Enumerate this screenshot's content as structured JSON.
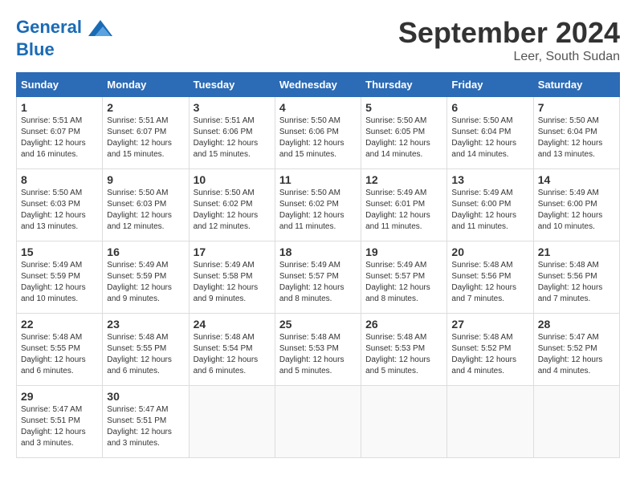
{
  "logo": {
    "line1": "General",
    "line2": "Blue"
  },
  "title": "September 2024",
  "location": "Leer, South Sudan",
  "days_of_week": [
    "Sunday",
    "Monday",
    "Tuesday",
    "Wednesday",
    "Thursday",
    "Friday",
    "Saturday"
  ],
  "weeks": [
    [
      {
        "day": 1,
        "sunrise": "5:51 AM",
        "sunset": "6:07 PM",
        "daylight": "12 hours and 16 minutes."
      },
      {
        "day": 2,
        "sunrise": "5:51 AM",
        "sunset": "6:07 PM",
        "daylight": "12 hours and 15 minutes."
      },
      {
        "day": 3,
        "sunrise": "5:51 AM",
        "sunset": "6:06 PM",
        "daylight": "12 hours and 15 minutes."
      },
      {
        "day": 4,
        "sunrise": "5:50 AM",
        "sunset": "6:06 PM",
        "daylight": "12 hours and 15 minutes."
      },
      {
        "day": 5,
        "sunrise": "5:50 AM",
        "sunset": "6:05 PM",
        "daylight": "12 hours and 14 minutes."
      },
      {
        "day": 6,
        "sunrise": "5:50 AM",
        "sunset": "6:04 PM",
        "daylight": "12 hours and 14 minutes."
      },
      {
        "day": 7,
        "sunrise": "5:50 AM",
        "sunset": "6:04 PM",
        "daylight": "12 hours and 13 minutes."
      }
    ],
    [
      {
        "day": 8,
        "sunrise": "5:50 AM",
        "sunset": "6:03 PM",
        "daylight": "12 hours and 13 minutes."
      },
      {
        "day": 9,
        "sunrise": "5:50 AM",
        "sunset": "6:03 PM",
        "daylight": "12 hours and 12 minutes."
      },
      {
        "day": 10,
        "sunrise": "5:50 AM",
        "sunset": "6:02 PM",
        "daylight": "12 hours and 12 minutes."
      },
      {
        "day": 11,
        "sunrise": "5:50 AM",
        "sunset": "6:02 PM",
        "daylight": "12 hours and 11 minutes."
      },
      {
        "day": 12,
        "sunrise": "5:49 AM",
        "sunset": "6:01 PM",
        "daylight": "12 hours and 11 minutes."
      },
      {
        "day": 13,
        "sunrise": "5:49 AM",
        "sunset": "6:00 PM",
        "daylight": "12 hours and 11 minutes."
      },
      {
        "day": 14,
        "sunrise": "5:49 AM",
        "sunset": "6:00 PM",
        "daylight": "12 hours and 10 minutes."
      }
    ],
    [
      {
        "day": 15,
        "sunrise": "5:49 AM",
        "sunset": "5:59 PM",
        "daylight": "12 hours and 10 minutes."
      },
      {
        "day": 16,
        "sunrise": "5:49 AM",
        "sunset": "5:59 PM",
        "daylight": "12 hours and 9 minutes."
      },
      {
        "day": 17,
        "sunrise": "5:49 AM",
        "sunset": "5:58 PM",
        "daylight": "12 hours and 9 minutes."
      },
      {
        "day": 18,
        "sunrise": "5:49 AM",
        "sunset": "5:57 PM",
        "daylight": "12 hours and 8 minutes."
      },
      {
        "day": 19,
        "sunrise": "5:49 AM",
        "sunset": "5:57 PM",
        "daylight": "12 hours and 8 minutes."
      },
      {
        "day": 20,
        "sunrise": "5:48 AM",
        "sunset": "5:56 PM",
        "daylight": "12 hours and 7 minutes."
      },
      {
        "day": 21,
        "sunrise": "5:48 AM",
        "sunset": "5:56 PM",
        "daylight": "12 hours and 7 minutes."
      }
    ],
    [
      {
        "day": 22,
        "sunrise": "5:48 AM",
        "sunset": "5:55 PM",
        "daylight": "12 hours and 6 minutes."
      },
      {
        "day": 23,
        "sunrise": "5:48 AM",
        "sunset": "5:55 PM",
        "daylight": "12 hours and 6 minutes."
      },
      {
        "day": 24,
        "sunrise": "5:48 AM",
        "sunset": "5:54 PM",
        "daylight": "12 hours and 6 minutes."
      },
      {
        "day": 25,
        "sunrise": "5:48 AM",
        "sunset": "5:53 PM",
        "daylight": "12 hours and 5 minutes."
      },
      {
        "day": 26,
        "sunrise": "5:48 AM",
        "sunset": "5:53 PM",
        "daylight": "12 hours and 5 minutes."
      },
      {
        "day": 27,
        "sunrise": "5:48 AM",
        "sunset": "5:52 PM",
        "daylight": "12 hours and 4 minutes."
      },
      {
        "day": 28,
        "sunrise": "5:47 AM",
        "sunset": "5:52 PM",
        "daylight": "12 hours and 4 minutes."
      }
    ],
    [
      {
        "day": 29,
        "sunrise": "5:47 AM",
        "sunset": "5:51 PM",
        "daylight": "12 hours and 3 minutes."
      },
      {
        "day": 30,
        "sunrise": "5:47 AM",
        "sunset": "5:51 PM",
        "daylight": "12 hours and 3 minutes."
      },
      null,
      null,
      null,
      null,
      null
    ]
  ]
}
